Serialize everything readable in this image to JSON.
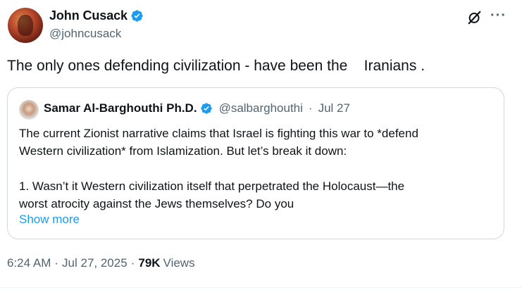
{
  "author": {
    "display_name": "John Cusack",
    "handle": "@johncusack"
  },
  "tweet": {
    "text": "The only ones defending civilization - have been the    Iranians ."
  },
  "quoted_tweet": {
    "display_name": "Samar Al-Barghouthi Ph.D.",
    "handle": "@salbarghouthi",
    "separator": "·",
    "date": "Jul 27",
    "paragraph1_line1": "The current Zionist narrative claims that Israel is fighting this war to *defend",
    "paragraph1_line2": "Western civilization* from Islamization. But let’s break it down:",
    "paragraph2_line1": "1. Wasn’t it Western civilization itself that perpetrated the Holocaust—the",
    "paragraph2_line2": "worst atrocity against the Jews themselves? Do you",
    "show_more": "Show more"
  },
  "meta": {
    "time": "6:24 AM",
    "separator": "·",
    "date": "Jul 27, 2025",
    "views_count": "79K",
    "views_label": "Views"
  },
  "icons": {
    "verified": "verified-badge-icon",
    "grok": "grok-icon",
    "more": "more-options-icon"
  },
  "colors": {
    "verified_blue": "#1d9bf0",
    "link_blue": "#1d9bf0",
    "secondary_text": "#536471",
    "primary_text": "#0f1419",
    "border": "#cfd9de"
  }
}
